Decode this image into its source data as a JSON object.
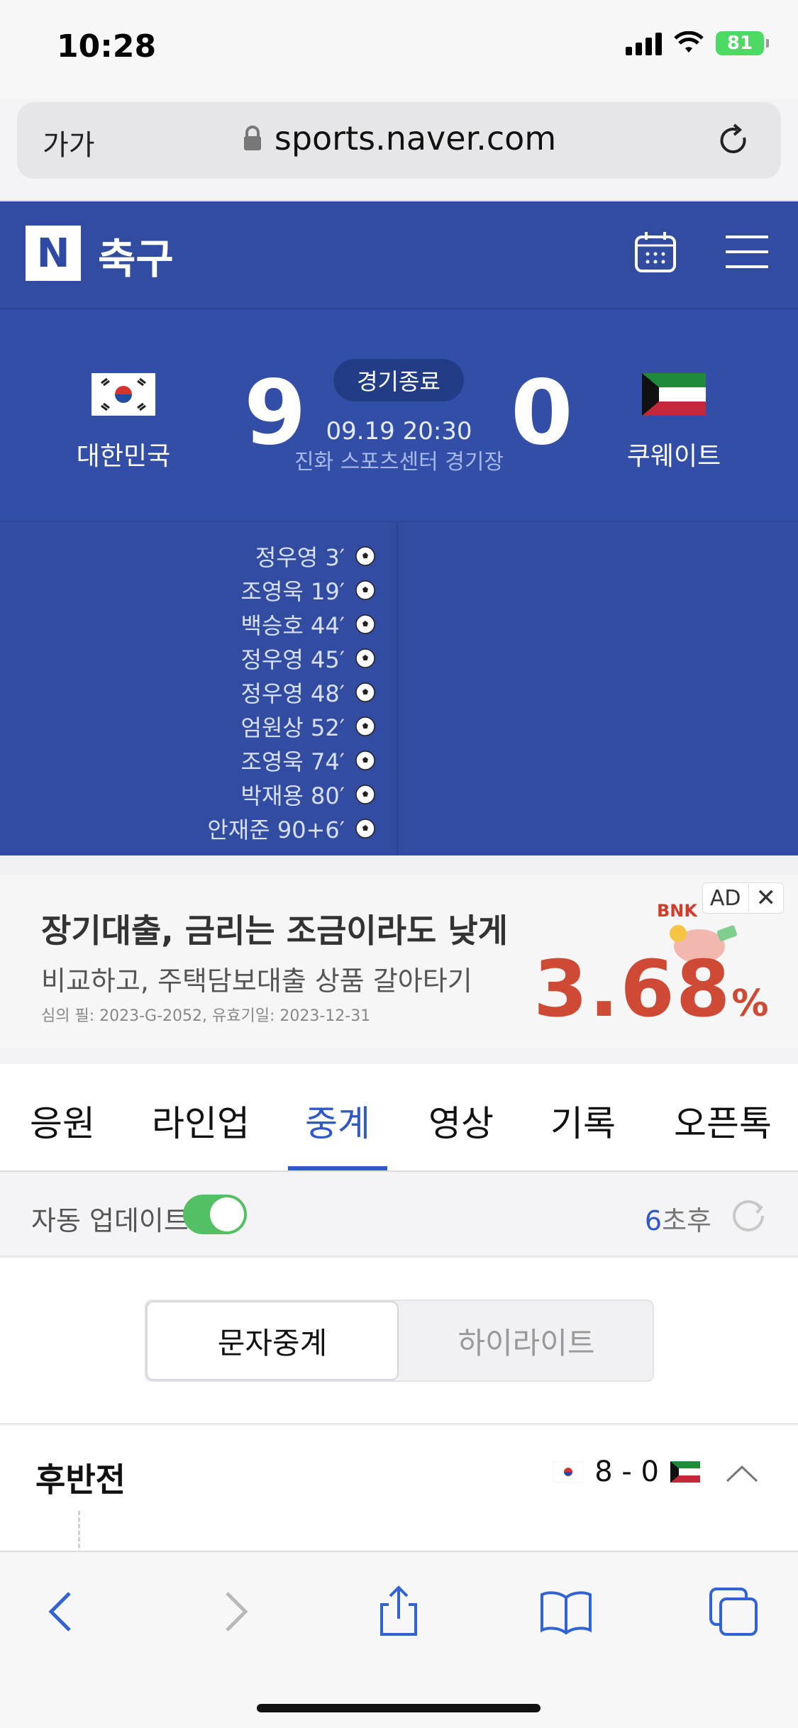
{
  "status_bar": {
    "time": "10:28",
    "battery": "81"
  },
  "browser": {
    "text_size_label": "가가",
    "url": "sports.naver.com"
  },
  "header": {
    "logo": "N",
    "title": "축구"
  },
  "match": {
    "home_team": "대한민국",
    "away_team": "쿠웨이트",
    "home_score": "9",
    "away_score": "0",
    "status": "경기종료",
    "datetime": "09.19 20:30",
    "venue": "진화 스포츠센터 경기장"
  },
  "goals": [
    {
      "text": "정우영 3′"
    },
    {
      "text": "조영욱 19′"
    },
    {
      "text": "백승호 44′"
    },
    {
      "text": "정우영 45′"
    },
    {
      "text": "정우영 48′"
    },
    {
      "text": "엄원상 52′"
    },
    {
      "text": "조영욱 74′"
    },
    {
      "text": "박재용 80′"
    },
    {
      "text": "안재준 90+6′"
    }
  ],
  "ad": {
    "title": "장기대출, 금리는 조금이라도 낮게",
    "subtitle": "비교하고, 주택담보대출 상품 갈아타기",
    "note": "심의 필: 2023-G-2052, 유효기일: 2023-12-31",
    "rate": "3.68",
    "rate_unit": "%",
    "brand": "BNK",
    "badge": "AD",
    "close": "✕"
  },
  "tabs": [
    "응원",
    "라인업",
    "중계",
    "영상",
    "기록",
    "오픈톡"
  ],
  "active_tab": "중계",
  "auto_update": {
    "label": "자동 업데이트",
    "countdown_num": "6",
    "countdown_suffix": "초후"
  },
  "segment": {
    "text_live": "문자중계",
    "highlight": "하이라이트"
  },
  "half": {
    "title": "후반전",
    "score": "8 - 0"
  },
  "colors": {
    "naver_blue": "#324ca1",
    "accent": "#2f58c8",
    "toggle_on": "#53c163"
  }
}
